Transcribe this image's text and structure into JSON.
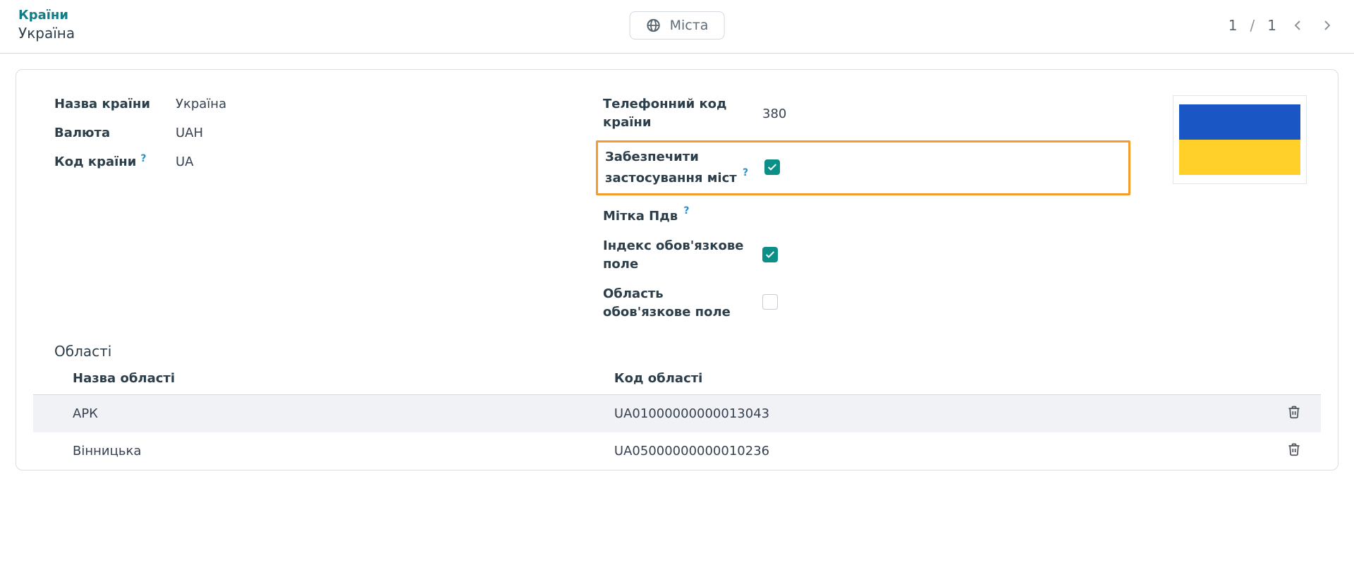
{
  "breadcrumb": {
    "parent": "Країни",
    "current": "Україна"
  },
  "header_button": {
    "label": "Міста"
  },
  "pager": {
    "current": "1",
    "total": "1"
  },
  "left": {
    "name_label": "Назва країни",
    "name_value": "Україна",
    "currency_label": "Валюта",
    "currency_value": "UAH",
    "code_label": "Код країни",
    "code_value": "UA"
  },
  "right": {
    "phone_label": "Телефонний код країни",
    "phone_value": "380",
    "enforce_cities_label": "Забезпечити застосування міст",
    "enforce_cities_checked": true,
    "vat_label": "Мітка Пдв",
    "zip_required_label": "Індекс обов'язкове поле",
    "zip_required_checked": true,
    "state_required_label": "Область обов'язкове поле",
    "state_required_checked": false
  },
  "regions": {
    "title": "Області",
    "col_name": "Назва області",
    "col_code": "Код області",
    "rows": [
      {
        "name": "АРК",
        "code": "UA01000000000013043"
      },
      {
        "name": "Вінницька",
        "code": "UA05000000000010236"
      }
    ]
  }
}
